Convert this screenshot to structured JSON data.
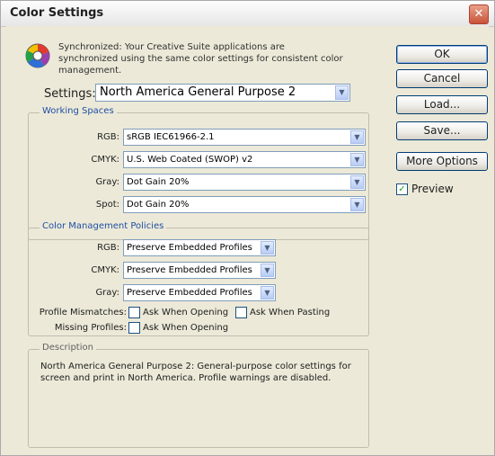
{
  "window": {
    "title": "Color Settings",
    "close_glyph": "✕"
  },
  "sync": {
    "icon": "color-wheel-icon",
    "text": "Synchronized: Your Creative Suite applications are synchronized using the same color settings for consistent color management."
  },
  "settings": {
    "label": "Settings:",
    "value": "North America General Purpose 2"
  },
  "working_spaces": {
    "title": "Working Spaces",
    "rgb_label": "RGB:",
    "rgb_value": "sRGB IEC61966-2.1",
    "cmyk_label": "CMYK:",
    "cmyk_value": "U.S. Web Coated (SWOP) v2",
    "gray_label": "Gray:",
    "gray_value": "Dot Gain 20%",
    "spot_label": "Spot:",
    "spot_value": "Dot Gain 20%"
  },
  "policies": {
    "title": "Color Management Policies",
    "rgb_label": "RGB:",
    "rgb_value": "Preserve Embedded Profiles",
    "cmyk_label": "CMYK:",
    "cmyk_value": "Preserve Embedded Profiles",
    "gray_label": "Gray:",
    "gray_value": "Preserve Embedded Profiles",
    "mismatch_label": "Profile Mismatches:",
    "ask_opening": "Ask When Opening",
    "ask_pasting": "Ask When Pasting",
    "missing_label": "Missing Profiles:",
    "ask_opening_missing": "Ask When Opening"
  },
  "description": {
    "title": "Description",
    "text": "North America General Purpose 2:  General-purpose color settings for screen and print in North America. Profile warnings are disabled."
  },
  "buttons": {
    "ok": "OK",
    "cancel": "Cancel",
    "load": "Load...",
    "save": "Save...",
    "more_options": "More Options"
  },
  "preview": {
    "label": "Preview",
    "checked": true,
    "check_glyph": "✓"
  },
  "colors": {
    "title_close": "#c8543a",
    "group_label": "#1f4fa3",
    "dialog_bg": "#ece9d8"
  }
}
